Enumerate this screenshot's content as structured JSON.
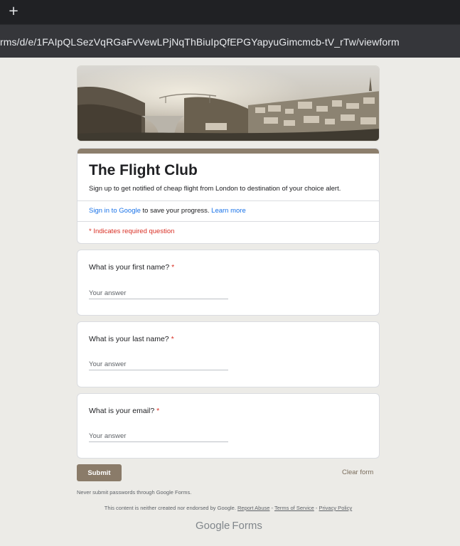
{
  "browser": {
    "new_tab_icon": "+",
    "url": "rms/d/e/1FAIpQLSezVqRGaFvVewLPjNqThBiuIpQfEPGYapyuGimcmcb-tV_rTw/viewform"
  },
  "form": {
    "title": "The Flight Club",
    "description": "Sign up to get notified of cheap flight from London to destination of your choice alert.",
    "signin_link": "Sign in to Google",
    "signin_text": " to save your progress. ",
    "learn_more": "Learn more",
    "required_note": "* Indicates required question",
    "accent_color": "#8c7e6c"
  },
  "questions": [
    {
      "label": "What is your first name?",
      "required_mark": "*",
      "placeholder": "Your answer"
    },
    {
      "label": "What is your last name?",
      "required_mark": "*",
      "placeholder": "Your answer"
    },
    {
      "label": "What is your email?",
      "required_mark": "*",
      "placeholder": "Your answer"
    }
  ],
  "actions": {
    "submit_label": "Submit",
    "clear_label": "Clear form"
  },
  "footer": {
    "warning": "Never submit passwords through Google Forms.",
    "disclaimer_text": "This content is neither created nor endorsed by Google. ",
    "report_abuse": "Report Abuse",
    "sep1": " - ",
    "terms": "Terms of Service",
    "sep2": " - ",
    "privacy": "Privacy Policy",
    "logo_google": "Google",
    "logo_forms": "Forms"
  }
}
